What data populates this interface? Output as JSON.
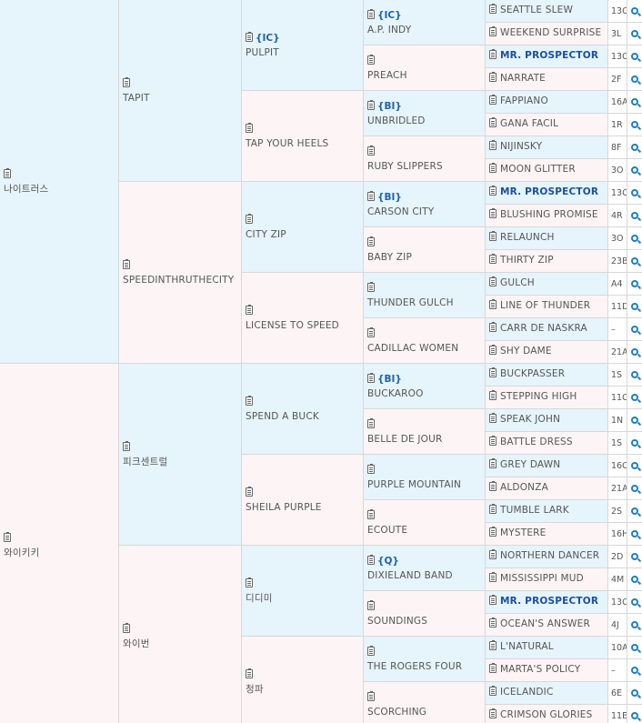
{
  "gen1": [
    {
      "name": "나이트러스"
    },
    {
      "name": "와이키키"
    }
  ],
  "gen2": [
    {
      "name": "TAPIT"
    },
    {
      "name": "SPEEDINTHRUTHECITY"
    },
    {
      "name": "피크센트럴"
    },
    {
      "name": "와이번"
    }
  ],
  "gen3": [
    {
      "name": "PULPIT",
      "tag": "{IC}"
    },
    {
      "name": "TAP YOUR HEELS"
    },
    {
      "name": "CITY ZIP"
    },
    {
      "name": "LICENSE TO SPEED"
    },
    {
      "name": "SPEND A BUCK"
    },
    {
      "name": "SHEILA PURPLE"
    },
    {
      "name": "디디미"
    },
    {
      "name": "청파"
    }
  ],
  "gen4": [
    {
      "name": "A.P. INDY",
      "tag": "{IC}"
    },
    {
      "name": "PREACH"
    },
    {
      "name": "UNBRIDLED",
      "tag": "{BI}"
    },
    {
      "name": "RUBY SLIPPERS"
    },
    {
      "name": "CARSON CITY",
      "tag": "{BI}"
    },
    {
      "name": "BABY ZIP"
    },
    {
      "name": "THUNDER GULCH"
    },
    {
      "name": "CADILLAC WOMEN"
    },
    {
      "name": "BUCKAROO",
      "tag": "{BI}"
    },
    {
      "name": "BELLE DE JOUR"
    },
    {
      "name": "PURPLE MOUNTAIN"
    },
    {
      "name": "ECOUTE"
    },
    {
      "name": "DIXIELAND BAND",
      "tag": "{Q}"
    },
    {
      "name": "SOUNDINGS"
    },
    {
      "name": "THE ROGERS FOUR"
    },
    {
      "name": "SCORCHING"
    }
  ],
  "gen5": [
    {
      "name": "SEATTLE SLEW",
      "count": "13C"
    },
    {
      "name": "WEEKEND SURPRISE",
      "count": "3L"
    },
    {
      "name": "MR. PROSPECTOR",
      "count": "13C",
      "bold": true
    },
    {
      "name": "NARRATE",
      "count": "2F"
    },
    {
      "name": "FAPPIANO",
      "count": "16A"
    },
    {
      "name": "GANA FACIL",
      "count": "1R"
    },
    {
      "name": "NIJINSKY",
      "count": "8F"
    },
    {
      "name": "MOON GLITTER",
      "count": "3O"
    },
    {
      "name": "MR. PROSPECTOR",
      "count": "13C",
      "bold": true
    },
    {
      "name": "BLUSHING PROMISE",
      "count": "4R"
    },
    {
      "name": "RELAUNCH",
      "count": "3O"
    },
    {
      "name": "THIRTY ZIP",
      "count": "23B"
    },
    {
      "name": "GULCH",
      "count": "A4"
    },
    {
      "name": "LINE OF THUNDER",
      "count": "11D"
    },
    {
      "name": "CARR DE NASKRA",
      "count": "–"
    },
    {
      "name": "SHY DAME",
      "count": "21A"
    },
    {
      "name": "BUCKPASSER",
      "count": "1S"
    },
    {
      "name": "STEPPING HIGH",
      "count": "11C"
    },
    {
      "name": "SPEAK JOHN",
      "count": "1N"
    },
    {
      "name": "BATTLE DRESS",
      "count": "1S"
    },
    {
      "name": "GREY DAWN",
      "count": "16C"
    },
    {
      "name": "ALDONZA",
      "count": "21A"
    },
    {
      "name": "TUMBLE LARK",
      "count": "2S"
    },
    {
      "name": "MYSTERE",
      "count": "16H"
    },
    {
      "name": "NORTHERN DANCER",
      "count": "2D"
    },
    {
      "name": "MISSISSIPPI MUD",
      "count": "4M"
    },
    {
      "name": "MR. PROSPECTOR",
      "count": "13C",
      "bold": true
    },
    {
      "name": "OCEAN'S ANSWER",
      "count": "4J"
    },
    {
      "name": "L'NATURAL",
      "count": "10A"
    },
    {
      "name": "MARTA'S POLICY",
      "count": "–"
    },
    {
      "name": "ICELANDIC",
      "count": "6E"
    },
    {
      "name": "CRIMSON GLORIES",
      "count": "11E"
    }
  ]
}
